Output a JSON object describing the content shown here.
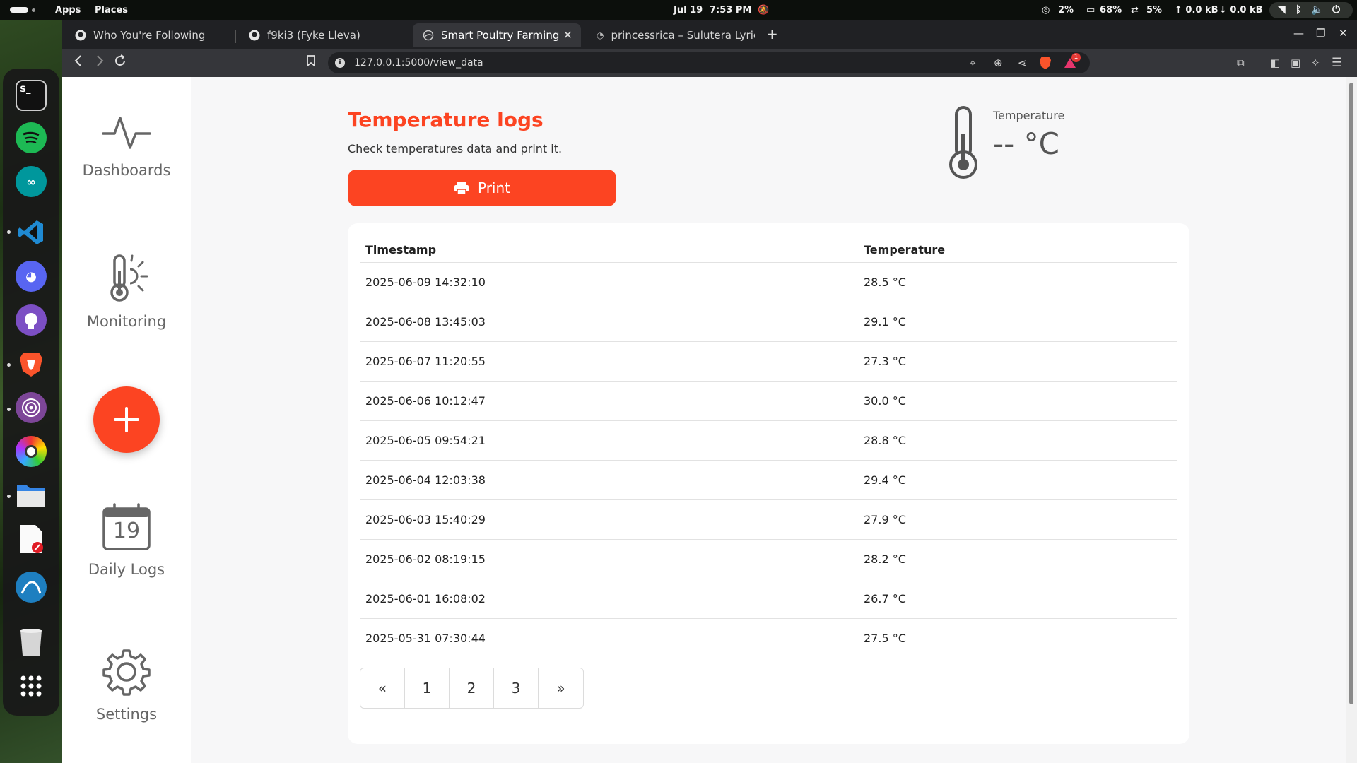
{
  "topbar": {
    "apps": "Apps",
    "places": "Places",
    "date": "Jul 19",
    "time": "7:53 PM",
    "cpu": "2%",
    "mem": "68%",
    "swap": "5%",
    "net_up": "↑ 0.0 kB",
    "net_down": "↓ 0.0 kB"
  },
  "dock": {
    "apps": [
      "terminal-icon",
      "spotify-icon",
      "arduino-icon",
      "vscode-icon",
      "discord-icon",
      "github-desktop-icon",
      "brave-icon",
      "tor-icon",
      "color-picker-icon",
      "files-icon",
      "text-editor-icon",
      "wireshark-icon",
      "trash-icon",
      "app-grid-icon"
    ]
  },
  "browser": {
    "tabs": [
      {
        "label": "Who You're Following"
      },
      {
        "label": "f9ki3 (Fyke Lleva)"
      },
      {
        "label": "Smart Poultry Farming"
      },
      {
        "label": "princessrica – Sulutera Lyrics"
      }
    ],
    "new_tab": "+",
    "url": "127.0.0.1:5000/view_data",
    "notif_count": "1"
  },
  "sidebar": {
    "items": [
      {
        "label": "Dashboards"
      },
      {
        "label": "Monitoring"
      },
      {
        "label": "Daily Logs",
        "calendar_day": "19"
      },
      {
        "label": "Settings"
      }
    ]
  },
  "header": {
    "title": "Temperature logs",
    "subtitle": "Check temperatures data and print it.",
    "print_label": "Print"
  },
  "temp_widget": {
    "label": "Temperature",
    "value": "-- °C"
  },
  "table": {
    "columns": [
      "Timestamp",
      "Temperature"
    ],
    "rows": [
      [
        "2025-06-09 14:32:10",
        "28.5 °C"
      ],
      [
        "2025-06-08 13:45:03",
        "29.1 °C"
      ],
      [
        "2025-06-07 11:20:55",
        "27.3 °C"
      ],
      [
        "2025-06-06 10:12:47",
        "30.0 °C"
      ],
      [
        "2025-06-05 09:54:21",
        "28.8 °C"
      ],
      [
        "2025-06-04 12:03:38",
        "29.4 °C"
      ],
      [
        "2025-06-03 15:40:29",
        "27.9 °C"
      ],
      [
        "2025-06-02 08:19:15",
        "28.2 °C"
      ],
      [
        "2025-06-01 16:08:02",
        "26.7 °C"
      ],
      [
        "2025-05-31 07:30:44",
        "27.5 °C"
      ]
    ]
  },
  "pagination": {
    "prev": "«",
    "pages": [
      "1",
      "2",
      "3"
    ],
    "next": "»"
  },
  "colors": {
    "accent": "#fc4422"
  }
}
